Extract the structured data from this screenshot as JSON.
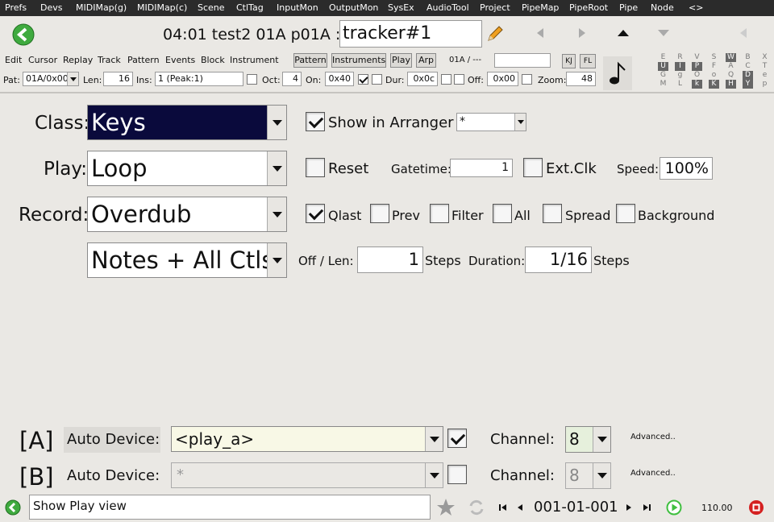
{
  "menu": [
    "Prefs",
    "Devs",
    "MIDIMap(g)",
    "MIDIMap(c)",
    "Scene",
    "CtlTag",
    "InputMon",
    "OutputMon",
    "SysEx",
    "AudioTool",
    "Project",
    "PipeMap",
    "PipeRoot",
    "Pipe",
    "Node",
    "<>"
  ],
  "header": {
    "title": "04:01 test2  01A  p01A :",
    "name_value": "tracker#1"
  },
  "menu2": [
    "Edit",
    "Cursor",
    "Replay",
    "Track",
    "Pattern",
    "Events",
    "Block",
    "Instrument"
  ],
  "tabs": {
    "pattern": "Pattern",
    "instruments": "Instruments",
    "play": "Play",
    "arp": "Arp"
  },
  "status": {
    "pos": "01A / ---",
    "kj": "KJ",
    "fl": "FL"
  },
  "row3": {
    "pat_label": "Pat:",
    "pat_value": "01A/0x00",
    "len_label": "Len:",
    "len_value": "16",
    "ins_label": "Ins:",
    "ins_value": "1 (Peak:1)",
    "oct_label": "Oct:",
    "oct_value": "4",
    "on_label": "On:",
    "on_value": "0x40",
    "dur_label": "Dur:",
    "dur_value": "0x0c",
    "off_label": "Off:",
    "off_value": "0x00",
    "zoom_label": "Zoom:",
    "zoom_value": "48"
  },
  "grid": [
    [
      "E",
      "R",
      "V",
      "S",
      "W",
      "B",
      "X"
    ],
    [
      "U",
      "I",
      "P",
      "F",
      "A",
      "C",
      "T"
    ],
    [
      "G",
      "g",
      "O",
      "o",
      "Q",
      "D",
      "e"
    ],
    [
      "M",
      "L",
      "k",
      "K",
      "H",
      "Y",
      "p"
    ]
  ],
  "main": {
    "class_label": "Class:",
    "class_value": "Keys",
    "show_arranger_label": "Show in Arranger",
    "arranger_value": "*",
    "play_label": "Play:",
    "play_value": "Loop",
    "reset_label": "Reset",
    "gatetime_label": "Gatetime:",
    "gatetime_value": "1",
    "extclk_label": "Ext.Clk",
    "speed_label": "Speed:",
    "speed_value": "100%",
    "record_label": "Record:",
    "record_value": "Overdub",
    "qlast_label": "Qlast",
    "prev_label": "Prev",
    "filter_label": "Filter",
    "all_label": "All",
    "spread_label": "Spread",
    "background_label": "Background",
    "notes_value": "Notes + All Ctls",
    "offlen_label": "Off / Len:",
    "offlen_value": "1",
    "steps1_label": "Steps",
    "duration_label": "Duration:",
    "duration_value": "1/16",
    "steps2_label": "Steps"
  },
  "devices": [
    {
      "tag": "[A]",
      "label": "Auto Device:",
      "value": "<play_a>",
      "channel_label": "Channel:",
      "channel_value": "8",
      "advanced": "Advanced.."
    },
    {
      "tag": "[B]",
      "label": "Auto Device:",
      "value": "*",
      "channel_label": "Channel:",
      "channel_value": "8",
      "advanced": "Advanced.."
    }
  ],
  "footer": {
    "status_text": "Show Play view",
    "time": "001-01-001",
    "tempo": "110.00"
  },
  "colors": {
    "menubar": "#2b2b2b",
    "selected": "#0a0a3c",
    "device_field": "#f8f8e6",
    "channel_field": "#e6f0dc",
    "play_green": "#3fbf3f",
    "stop_red": "#d42020"
  }
}
